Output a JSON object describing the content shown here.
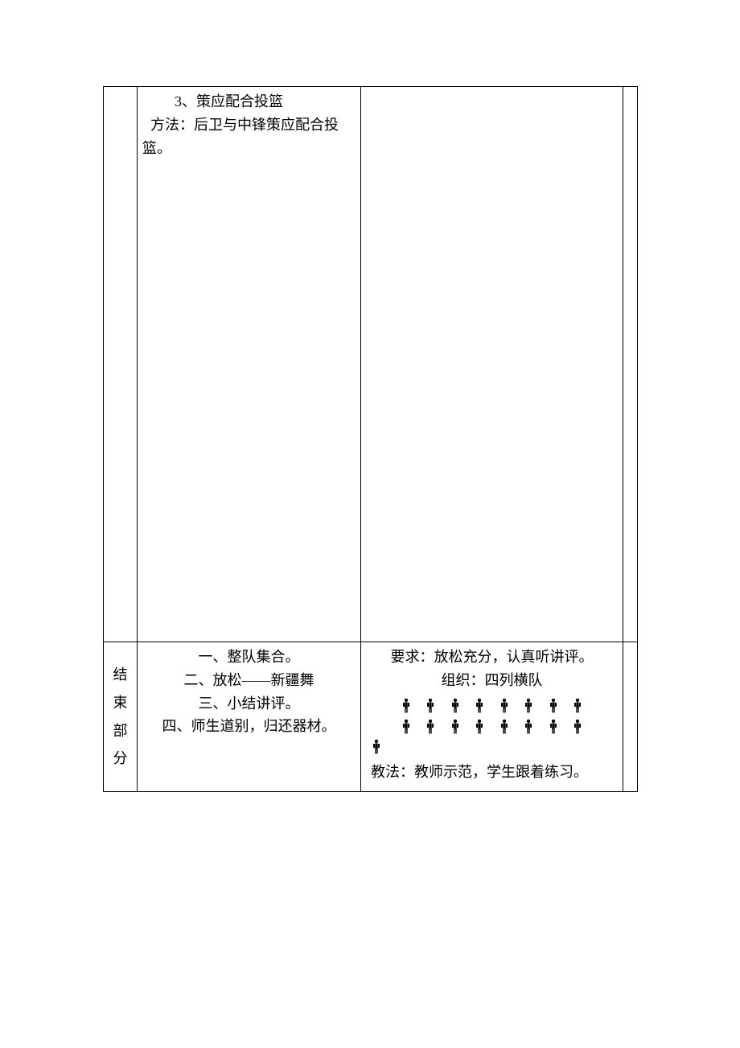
{
  "row1": {
    "content": {
      "title": "3、策应配合投篮",
      "method_line": "方法：后卫与中锋策应配合投篮。"
    }
  },
  "row2": {
    "section_chars": [
      "结",
      "束",
      "部",
      "分"
    ],
    "content": {
      "lines": [
        "一、整队集合。",
        "二、放松——新疆舞",
        "三、小结讲评。",
        "四、师生道别，归还器材。"
      ]
    },
    "org": {
      "req_line": "要求：放松充分，认真听讲评。",
      "org_line": "组织：四列横队",
      "method_line": "教法：教师示范，学生跟着练习。"
    }
  },
  "icons": {
    "person": "person-icon"
  }
}
